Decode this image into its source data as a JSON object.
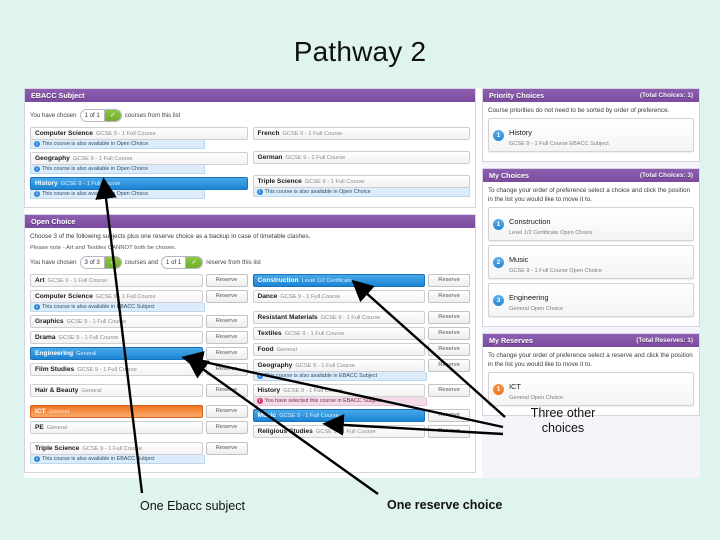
{
  "slide": {
    "title": "Pathway 2",
    "background_color": "#dff3ef"
  },
  "annotations": [
    {
      "id": "three-other-choices",
      "text": "Three other\nchoices"
    },
    {
      "id": "one-ebacc-subject",
      "text": "One Ebacc subject"
    },
    {
      "id": "one-reserve-choice",
      "text": "One reserve choice"
    }
  ],
  "annotation_text": {
    "three_other_choices_line1": "Three other",
    "three_other_choices_line2": "choices",
    "one_ebacc_subject": "One Ebacc subject",
    "one_reserve_choice": "One reserve choice"
  },
  "colors": {
    "panel_header_purple": "#7a4b9e",
    "selected_blue": "#1b84d4",
    "reserve_orange": "#f07422",
    "tick_green": "#6fae2e",
    "info_note_blue": "#dcecfa",
    "warn_note_pink": "#f4dbe9",
    "slide_background": "#dff3ef"
  },
  "ebacc_panel": {
    "header": "EBACC Subject",
    "counter": {
      "prefix": "You have chosen",
      "value": "1 of 1",
      "suffix": "courses from this list",
      "tick_icon": "check-icon"
    },
    "left_column": [
      {
        "name": "Computer Science",
        "meta": "GCSE 9 - 1 Full Course",
        "state": "default",
        "note": "This course is also available in Open Choice",
        "note_type": "info"
      },
      {
        "name": "Geography",
        "meta": "GCSE 9 - 1 Full Course",
        "state": "default",
        "note": "This course is also available in Open Choice",
        "note_type": "info"
      },
      {
        "name": "History",
        "meta": "GCSE 9 - 1 Full Course",
        "state": "selected",
        "note": "This course is also available in Open Choice",
        "note_type": "info"
      }
    ],
    "right_column": [
      {
        "name": "French",
        "meta": "GCSE 9 - 1 Full Course",
        "state": "default",
        "note": "",
        "note_type": ""
      },
      {
        "name": "German",
        "meta": "GCSE 9 - 1 Full Course",
        "state": "default",
        "note": "",
        "note_type": ""
      },
      {
        "name": "Triple Science",
        "meta": "GCSE 9 - 1 Full Course",
        "state": "default",
        "note": "This course is also available in Open Choice",
        "note_type": "info"
      }
    ]
  },
  "open_choice_panel": {
    "header": "Open Choice",
    "instruction_1": "Choose 3 of the following subjects plus one reserve choice as a backup in case of timetable clashes.",
    "instruction_2": "Please note - Art and Textiles CANNOT both be chosen.",
    "counter": {
      "prefix": "You have chosen",
      "courses_value": "3 of 3",
      "middle": "courses and",
      "reserve_value": "1 of 1",
      "suffix": "reserve from this list",
      "tick_icon": "check-icon"
    },
    "reserve_button_label": "Reserve",
    "left_column": [
      {
        "name": "Art",
        "meta": "GCSE 9 - 1 Full Course",
        "state": "default",
        "button": "Reserve",
        "note": "",
        "note_type": ""
      },
      {
        "name": "Computer Science",
        "meta": "GCSE 9 - 1 Full Course",
        "state": "default",
        "button": "Reserve",
        "note": "This course is also available in EBACC Subject",
        "note_type": "info"
      },
      {
        "name": "Graphics",
        "meta": "GCSE 9 - 1 Full Course",
        "state": "default",
        "button": "Reserve",
        "note": "",
        "note_type": ""
      },
      {
        "name": "Drama",
        "meta": "GCSE 9 - 1 Full Course",
        "state": "default",
        "button": "Reserve",
        "note": "",
        "note_type": ""
      },
      {
        "name": "Engineering",
        "meta": "General",
        "state": "selected",
        "button": "Reserve",
        "note": "",
        "note_type": ""
      },
      {
        "name": "Film Studies",
        "meta": "GCSE 9 - 1 Full Course",
        "state": "default",
        "button": "Reserve",
        "note": "",
        "note_type": ""
      },
      {
        "name": "Hair & Beauty",
        "meta": "General",
        "state": "default",
        "button": "Reserve",
        "note": "",
        "note_type": ""
      },
      {
        "name": "ICT",
        "meta": "General",
        "state": "reserved",
        "button": "Reserve",
        "note": "",
        "note_type": ""
      },
      {
        "name": "PE",
        "meta": "General",
        "state": "default",
        "button": "Reserve",
        "note": "",
        "note_type": ""
      },
      {
        "name": "Triple Science",
        "meta": "GCSE 9 - 1 Full Course",
        "state": "default",
        "button": "Reserve",
        "note": "This course is also available in EBACC Subject",
        "note_type": "info"
      }
    ],
    "right_column": [
      {
        "name": "Construction",
        "meta": "Level 1/2 Certificate",
        "state": "selected",
        "button": "Reserve",
        "note": "",
        "note_type": ""
      },
      {
        "name": "Dance",
        "meta": "GCSE 9 - 1 Full Course",
        "state": "default",
        "button": "Reserve",
        "note": "",
        "note_type": ""
      },
      {
        "name": "Resistant Materials",
        "meta": "GCSE 9 - 1 Full Course",
        "state": "default",
        "button": "Reserve",
        "note": "",
        "note_type": ""
      },
      {
        "name": "Textiles",
        "meta": "GCSE 9 - 1 Full Course",
        "state": "default",
        "button": "Reserve",
        "note": "",
        "note_type": ""
      },
      {
        "name": "Food",
        "meta": "General",
        "state": "default",
        "button": "Reserve",
        "note": "",
        "note_type": ""
      },
      {
        "name": "Geography",
        "meta": "GCSE 9 - 1 Full Course",
        "state": "default",
        "button": "Reserve",
        "note": "This course is also available in EBACC Subject",
        "note_type": "info"
      },
      {
        "name": "History",
        "meta": "GCSE 9 - 1 Full Course",
        "state": "default",
        "button": "Reserve",
        "note": "You have selected this course in EBACC Subject",
        "note_type": "warn"
      },
      {
        "name": "Music",
        "meta": "GCSE 9 - 1 Full Course",
        "state": "selected",
        "button": "Reserve",
        "note": "",
        "note_type": ""
      },
      {
        "name": "Religious Studies",
        "meta": "GCSE 9 - 1 Full Course",
        "state": "default",
        "button": "Reserve",
        "note": "",
        "note_type": ""
      }
    ]
  },
  "priority_choices_panel": {
    "header": "Priority Choices",
    "total": "(Total Choices: 1)",
    "help": "Course priorities do not need to be sorted by order of preference.",
    "items": [
      {
        "rank": "1",
        "title": "History",
        "meta": "GCSE 9 - 1 Full Course EBACC Subject"
      }
    ]
  },
  "my_choices_panel": {
    "header": "My Choices",
    "total": "(Total Choices: 3)",
    "help": "To change your order of preference select a choice and click the position in the list you would like to move it to.",
    "items": [
      {
        "rank": "1",
        "title": "Construction",
        "meta": "Level 1/2 Certificate Open Choice"
      },
      {
        "rank": "2",
        "title": "Music",
        "meta": "GCSE 9 - 1 Full Course Open Choice"
      },
      {
        "rank": "3",
        "title": "Engineering",
        "meta": "General Open Choice"
      }
    ]
  },
  "my_reserves_panel": {
    "header": "My Reserves",
    "total": "(Total Reserves: 1)",
    "help": "To change your order of preference select a reserve and click the position in the list you would like to move it to.",
    "items": [
      {
        "rank": "1",
        "title": "ICT",
        "meta": "General Open Choice"
      }
    ]
  }
}
